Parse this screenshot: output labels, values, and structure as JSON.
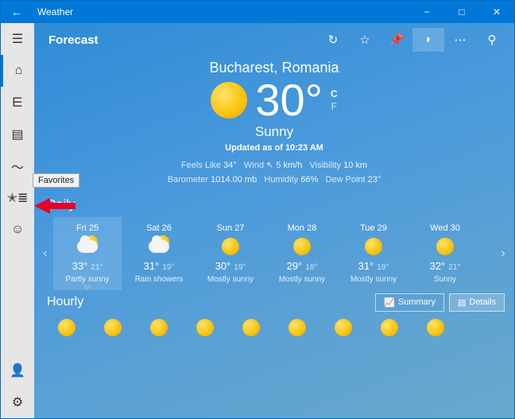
{
  "titlebar": {
    "app_name": "Weather"
  },
  "toolbar": {
    "forecast_label": "Forecast"
  },
  "current": {
    "location": "Bucharest, Romania",
    "temp": "30°",
    "unit_c": "C",
    "unit_f": "F",
    "condition": "Sunny",
    "updated": "Updated as of 10:23 AM",
    "stats_line1_feels": "Feels Like",
    "stats_line1_feels_v": "34°",
    "stats_line1_wind": "Wind",
    "stats_line1_wind_v": "5 km/h",
    "stats_line1_vis": "Visibility",
    "stats_line1_vis_v": "10 km",
    "stats_line2_bar": "Barometer",
    "stats_line2_bar_v": "1014.00 mb",
    "stats_line2_hum": "Humidity",
    "stats_line2_hum_v": "66%",
    "stats_line2_dew": "Dew Point",
    "stats_line2_dew_v": "23°"
  },
  "daily": {
    "title": "Daily",
    "days": [
      {
        "name": "Fri 25",
        "hi": "33°",
        "lo": "21°",
        "cond": "Partly sunny",
        "icon": "partly"
      },
      {
        "name": "Sat 26",
        "hi": "31°",
        "lo": "19°",
        "cond": "Rain showers",
        "icon": "rain"
      },
      {
        "name": "Sun 27",
        "hi": "30°",
        "lo": "19°",
        "cond": "Mostly sunny",
        "icon": "sun"
      },
      {
        "name": "Mon 28",
        "hi": "29°",
        "lo": "18°",
        "cond": "Mostly sunny",
        "icon": "sun"
      },
      {
        "name": "Tue 29",
        "hi": "31°",
        "lo": "19°",
        "cond": "Mostly sunny",
        "icon": "sun"
      },
      {
        "name": "Wed 30",
        "hi": "32°",
        "lo": "21°",
        "cond": "Sunny",
        "icon": "sun"
      }
    ]
  },
  "hourly": {
    "title": "Hourly",
    "summary": "Summary",
    "details": "Details"
  },
  "tooltip": "Favorites"
}
